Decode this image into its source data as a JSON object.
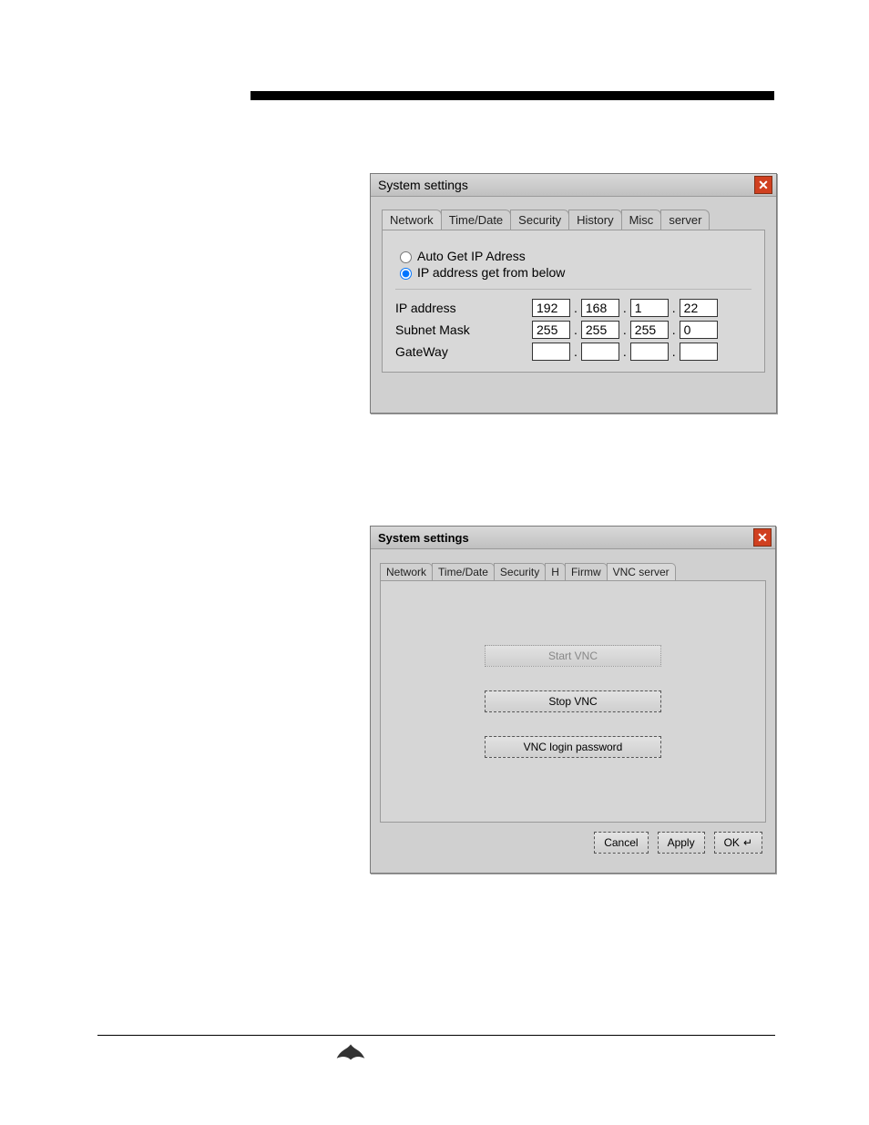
{
  "dialog1": {
    "title": "System settings",
    "tabs": [
      "Network",
      "Time/Date",
      "Security",
      "History",
      "Misc",
      "server"
    ],
    "radio_auto": "Auto Get IP Adress",
    "radio_manual": "IP address get from below",
    "rows": {
      "ip": {
        "label": "IP address",
        "o1": "192",
        "o2": "168",
        "o3": "1",
        "o4": "22"
      },
      "mask": {
        "label": "Subnet Mask",
        "o1": "255",
        "o2": "255",
        "o3": "255",
        "o4": "0"
      },
      "gw": {
        "label": "GateWay",
        "o1": "",
        "o2": "",
        "o3": "",
        "o4": ""
      }
    }
  },
  "dialog2": {
    "title": "System settings",
    "tabs": [
      "Network",
      "Time/Date",
      "Security",
      "H",
      "Firmw",
      "VNC server"
    ],
    "btn_start": "Start VNC",
    "btn_stop": "Stop VNC",
    "btn_pwd": "VNC login password",
    "btn_cancel": "Cancel",
    "btn_apply": "Apply",
    "btn_ok": "OK"
  }
}
